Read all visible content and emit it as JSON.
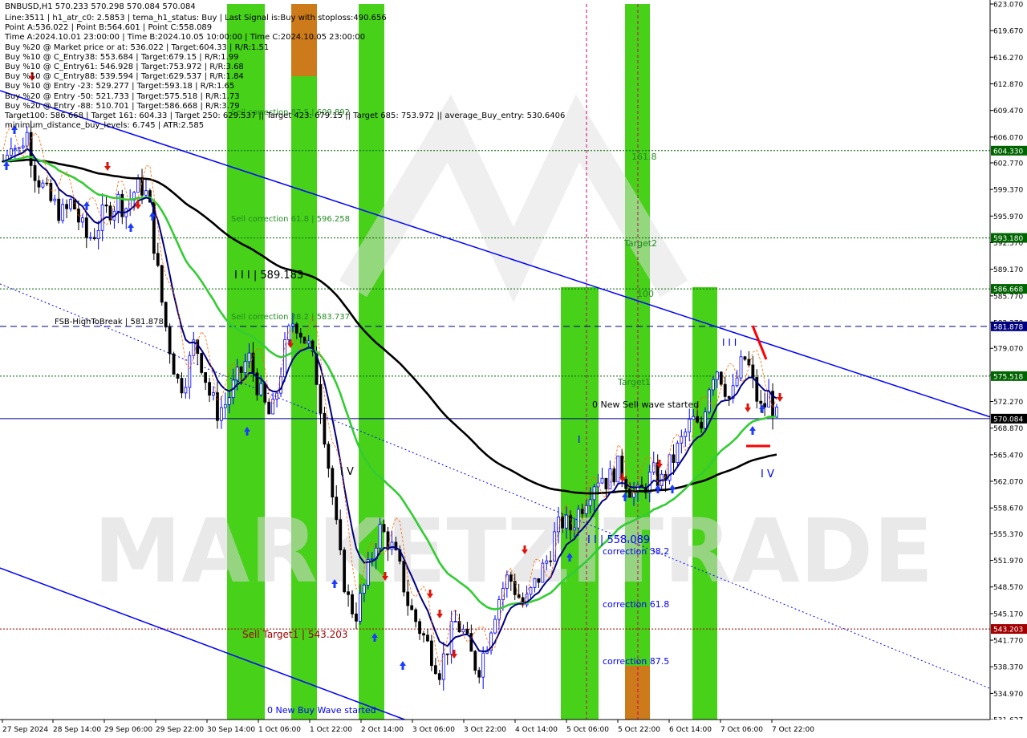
{
  "header": {
    "symbol_line": "BNBUSD,H1   570.233 570.298 570.084 570.084",
    "info_lines": [
      "Line:3511 | h1_atr_c0: 2.5853 | tema_h1_status: Buy | Last Signal is:Buy with stoploss:490.656",
      "Point A:536.022 | Point B:564.601 | Point C:558.089",
      "Time A:2024.10.01 23:00:00 | Time B:2024.10.05 10:00:00 | Time C:2024.10.05 23:00:00",
      "Buy %20 @ Market price or at: 536.022 | Target:604.33 | R/R:1.51",
      "Buy %10 @ C_Entry38: 553.684 | Target:679.15 | R/R:1.99",
      "Buy %10 @ C_Entry61: 546.928 | Target:753.972 | R/R:3.68",
      "Buy %10 @ C_Entry88: 539.594 | Target:629.537 | R/R:1.84",
      "Buy %10 @ Entry -23: 529.277 | Target:593.18 | R/R:1.65",
      "Buy %20 @ Entry -50: 521.733 | Target:575.518 | R/R:1.73",
      "Buy %20 @ Entry -88: 510.701 | Target:586.668 | R/R:3.79",
      "Target100: 586.668 | Target 161: 604.33 | Target 250: 629.537 || Target 423: 679.15 || Target 685: 753.972 || average_Buy_entry: 530.6406",
      "minimum_distance_buy_levels: 6.745 | ATR:2.585"
    ]
  },
  "watermark": "MARKETZITRADE",
  "colors": {
    "bull": "#0000ff",
    "bear": "#000000",
    "green_band": "#33cc00",
    "orange_band": "#cc7a1a",
    "ema_blue": "#000080",
    "ema_green": "#33cc33",
    "ema_black": "#000000",
    "trend_blue": "#0000ff",
    "dotted_blue": "#0000ff",
    "level_green": "#006400",
    "level_red": "#a00000",
    "price_box": "#000000"
  },
  "chart_data": {
    "type": "candlestick",
    "title": "BNBUSD,H1",
    "ylim": [
      531.627,
      623.07
    ],
    "y_ticks": [
      "623.070",
      "619.670",
      "616.270",
      "612.870",
      "609.470",
      "606.070",
      "602.770",
      "599.370",
      "595.970",
      "592.570",
      "589.170",
      "585.770",
      "582.370",
      "579.070",
      "575.670",
      "572.270",
      "568.870",
      "565.470",
      "562.070",
      "558.670",
      "555.370",
      "551.970",
      "548.570",
      "545.170",
      "541.770",
      "538.370",
      "534.970",
      "531.627"
    ],
    "x_ticks": [
      "27 Sep 2024",
      "28 Sep 14:00",
      "29 Sep 06:00",
      "29 Sep 22:00",
      "30 Sep 14:00",
      "1 Oct 06:00",
      "1 Oct 22:00",
      "2 Oct 14:00",
      "3 Oct 06:00",
      "3 Oct 22:00",
      "4 Oct 14:00",
      "5 Oct 06:00",
      "5 Oct 22:00",
      "6 Oct 14:00",
      "7 Oct 06:00",
      "7 Oct 22:00"
    ],
    "price_levels": [
      {
        "value": 604.33,
        "label": "604.330",
        "color": "#006400",
        "style": "dotted"
      },
      {
        "value": 593.18,
        "label": "593.180",
        "color": "#006400",
        "style": "dotted"
      },
      {
        "value": 586.668,
        "label": "586.668",
        "color": "#006400",
        "style": "dotted"
      },
      {
        "value": 581.878,
        "label": "581.878",
        "color": "#000080",
        "style": "dashed"
      },
      {
        "value": 575.518,
        "label": "575.518",
        "color": "#006400",
        "style": "dotted"
      },
      {
        "value": 570.084,
        "label": "570.084",
        "color": "#000080",
        "style": "solid"
      },
      {
        "value": 543.203,
        "label": "543.203",
        "color": "#a00000",
        "style": "dotted"
      }
    ],
    "annotations": [
      {
        "text": "Sell correction 87.5 | 609.892",
        "color": "#228b22"
      },
      {
        "text": "Sell correction 61.8 | 596.258",
        "color": "#228b22"
      },
      {
        "text": "I I I | 589.183",
        "color": "#000000"
      },
      {
        "text": "Sell correction 38.2 | 583.737",
        "color": "#228b22"
      },
      {
        "text": "FSB-HighToBreak | 581.878",
        "color": "#000000"
      },
      {
        "text": "I V",
        "color": "#000000"
      },
      {
        "text": "Sell Target1 | 543.203",
        "color": "#a00000"
      },
      {
        "text": "0 New Buy Wave started",
        "color": "#0000ff"
      },
      {
        "text": "161.8",
        "color": "#228b22"
      },
      {
        "text": "Target2",
        "color": "#228b22"
      },
      {
        "text": "100",
        "color": "#228b22"
      },
      {
        "text": "Target1",
        "color": "#228b22"
      },
      {
        "text": "0 New Sell wave started",
        "color": "#000000"
      },
      {
        "text": "I",
        "color": "#0000ff"
      },
      {
        "text": "I I | 558.089",
        "color": "#0000ff"
      },
      {
        "text": "correction 38.2",
        "color": "#0000ff"
      },
      {
        "text": "correction 61.8",
        "color": "#0000ff"
      },
      {
        "text": "correction 87.5",
        "color": "#0000ff"
      },
      {
        "text": "I I I",
        "color": "#0000ff"
      },
      {
        "text": "I V",
        "color": "#0000ff"
      }
    ],
    "close_path": [
      603,
      606,
      604,
      607,
      602,
      600,
      598,
      597,
      596,
      598,
      595,
      593,
      594,
      596,
      597,
      598,
      597,
      599,
      600,
      598,
      590,
      583,
      578,
      574,
      576,
      580,
      577,
      573,
      571,
      572,
      574,
      576,
      578,
      575,
      572,
      570,
      575,
      580,
      583,
      581,
      579,
      575,
      568,
      560,
      552,
      547,
      545,
      548,
      552,
      556,
      555,
      553,
      550,
      546,
      544,
      542,
      540,
      538,
      541,
      544,
      543,
      540,
      538,
      541,
      545,
      548,
      550,
      548,
      546,
      548,
      550,
      552,
      555,
      557,
      556,
      558,
      560,
      562,
      563,
      562,
      564,
      563,
      561,
      560,
      562,
      563,
      562,
      564,
      566,
      568,
      570,
      568,
      574,
      577,
      575,
      572,
      576,
      578,
      574,
      571,
      573,
      570
    ]
  }
}
